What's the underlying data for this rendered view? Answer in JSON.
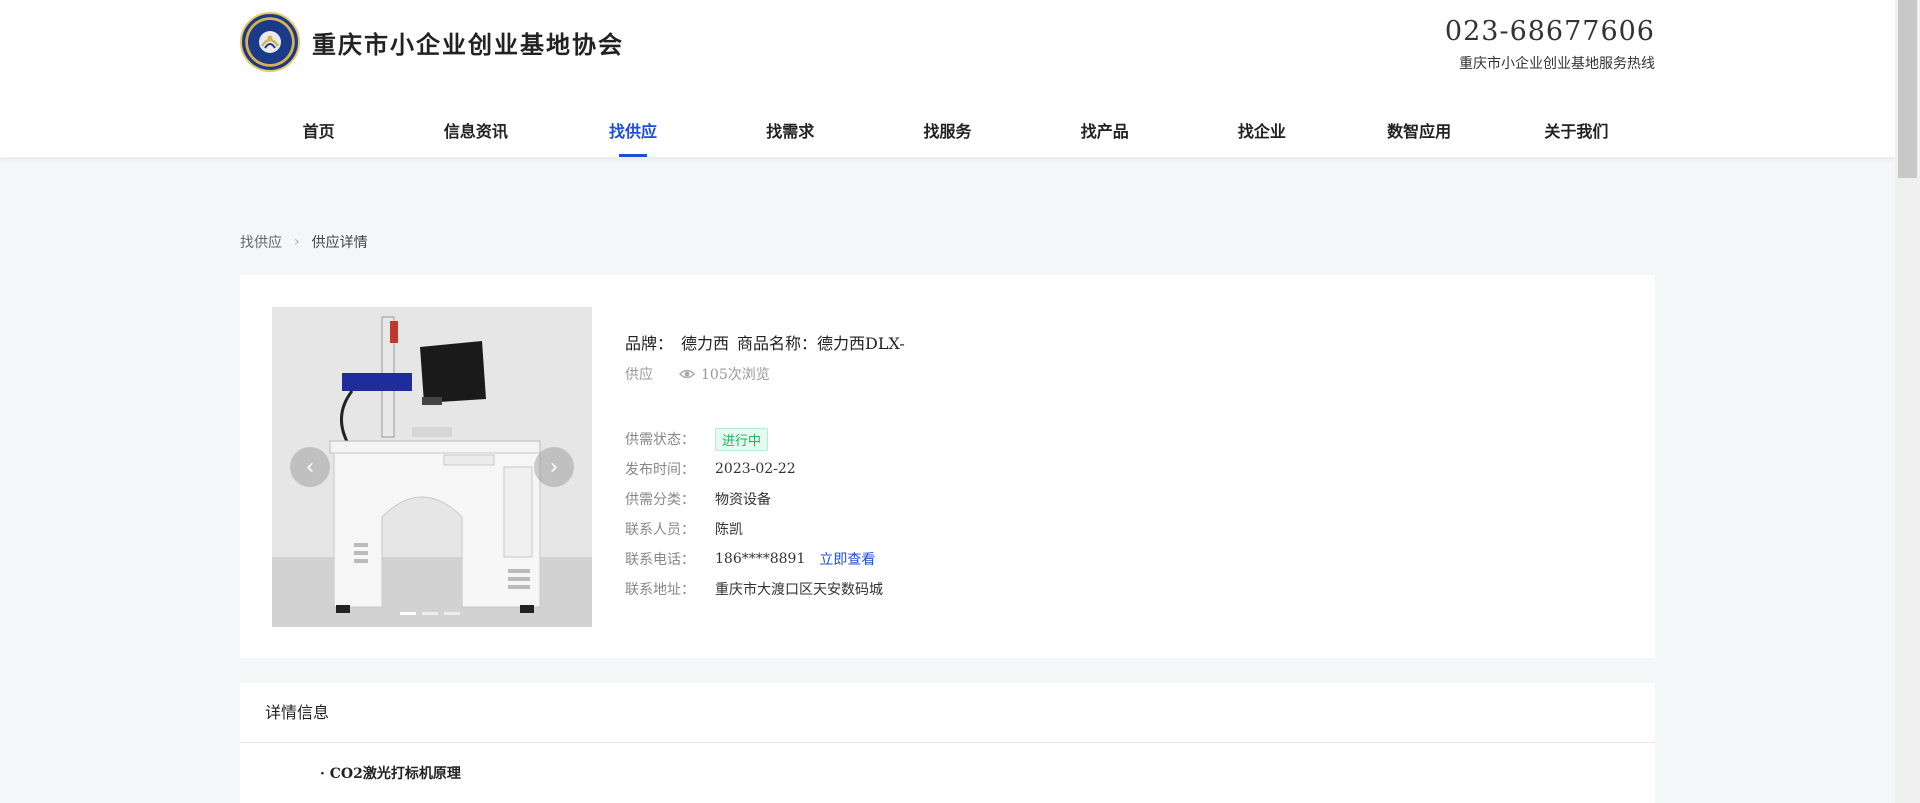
{
  "header": {
    "site_name": "重庆市小企业创业基地协会",
    "hotline_number": "023-68677606",
    "hotline_label": "重庆市小企业创业基地服务热线",
    "logo_icon": "association-logo-icon"
  },
  "nav": {
    "items": [
      {
        "label": "首页"
      },
      {
        "label": "信息资讯"
      },
      {
        "label": "找供应",
        "active": true
      },
      {
        "label": "找需求"
      },
      {
        "label": "找服务"
      },
      {
        "label": "找产品"
      },
      {
        "label": "找企业"
      },
      {
        "label": "数智应用"
      },
      {
        "label": "关于我们"
      }
    ],
    "active_color": "#1e4fd8"
  },
  "breadcrumb": {
    "parent": "找供应",
    "current": "供应详情"
  },
  "product": {
    "brand_label": "品牌：",
    "brand_value": "德力西",
    "name_label": "商品名称：",
    "name_value": "德力西DLX-",
    "type": "供应",
    "views": "105次浏览",
    "fields": {
      "status_label": "供需状态：",
      "status_value": "进行中",
      "publish_label": "发布时间：",
      "publish_value": "2023-02-22",
      "category_label": "供需分类：",
      "category_value": "物资设备",
      "contact_label": "联系人员：",
      "contact_value": "陈凯",
      "phone_label": "联系电话：",
      "phone_value": "186****8891",
      "phone_reveal": "立即查看",
      "address_label": "联系地址：",
      "address_value": "重庆市大渡口区天安数码城"
    },
    "gallery": {
      "prev_icon": "chevron-left-icon",
      "next_icon": "chevron-right-icon",
      "slides": 3,
      "active_slide": 1
    }
  },
  "details": {
    "title": "详情信息",
    "first_item": "· CO2激光打标机原理"
  },
  "colors": {
    "accent": "#1e4fd8",
    "status_green": "#15b85b",
    "page_bg": "#f5f6f8"
  }
}
